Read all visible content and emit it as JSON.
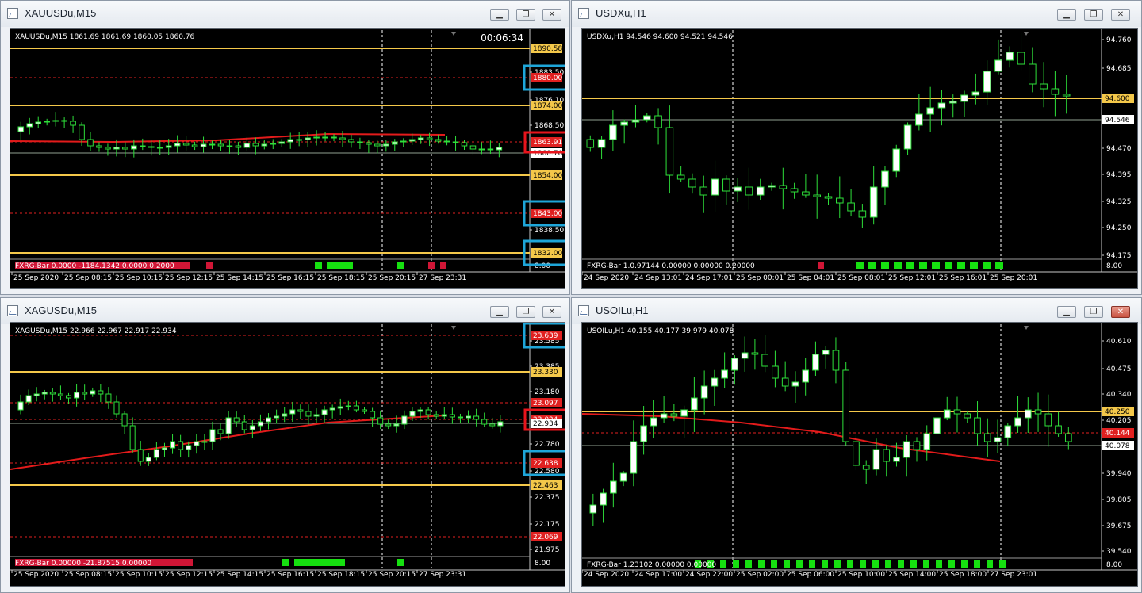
{
  "windows": [
    {
      "title": "XAUUSDu,M15",
      "info": "XAUUSDu,M15  1861.69 1861.69 1860.05 1860.76",
      "timer": "00:06:34",
      "indicator": "FXRG-Bar 0.0000  -1184.1342 0.0000 0.2000",
      "price_labels": [
        "1883.50",
        "1876.10",
        "1868.50",
        "1838.50"
      ],
      "levels": [
        {
          "label": "1890.58",
          "kind": "support",
          "boxed": false
        },
        {
          "label": "1880.00",
          "kind": "red",
          "boxed": "blue"
        },
        {
          "label": "1874.00",
          "kind": "support",
          "boxed": false
        },
        {
          "label": "1863.91",
          "kind": "red",
          "boxed": "red"
        },
        {
          "label": "1860.76",
          "kind": "current",
          "boxed": false
        },
        {
          "label": "1854.00",
          "kind": "support",
          "boxed": false
        },
        {
          "label": "1843.00",
          "kind": "red",
          "boxed": "blue"
        },
        {
          "label": "1832.00",
          "kind": "support",
          "boxed": "blue"
        }
      ],
      "axis_right_label": "8.00",
      "time_labels": [
        "25 Sep 2020",
        "25 Sep 08:15",
        "25 Sep 10:15",
        "25 Sep 12:15",
        "25 Sep 14:15",
        "25 Sep 16:15",
        "25 Sep 18:15",
        "25 Sep 20:15",
        "27 Sep 23:31"
      ]
    },
    {
      "title": "USDXu,H1",
      "info": "USDXu,H1  94.546 94.600 94.521 94.546",
      "timer": "",
      "indicator": "FXRG-Bar 1.0.97144 0.00000 0.00000 0.20000",
      "price_labels": [
        "94.760",
        "94.685",
        "94.470",
        "94.395",
        "94.325",
        "94.250",
        "94.175"
      ],
      "levels": [
        {
          "label": "94.600",
          "kind": "support",
          "boxed": false
        },
        {
          "label": "94.546",
          "kind": "current",
          "boxed": false
        }
      ],
      "axis_right_label": "8.00",
      "time_labels": [
        "24 Sep 2020",
        "24 Sep 13:01",
        "24 Sep 17:01",
        "25 Sep 00:01",
        "25 Sep 04:01",
        "25 Sep 08:01",
        "25 Sep 12:01",
        "25 Sep 16:01",
        "25 Sep 20:01"
      ]
    },
    {
      "title": "XAGUSDu,M15",
      "info": "XAGUSDu,M15  22.966 22.967 22.917 22.934",
      "timer": "",
      "indicator": "FXRG-Bar 0.00000 -21.87515 0.00000",
      "price_labels": [
        "23.585",
        "23.385",
        "23.180",
        "22.780",
        "22.580",
        "22.375",
        "22.175",
        "21.975"
      ],
      "levels": [
        {
          "label": "23.639",
          "kind": "red",
          "boxed": "blue"
        },
        {
          "label": "23.330",
          "kind": "support",
          "boxed": false
        },
        {
          "label": "23.097",
          "kind": "red",
          "boxed": false
        },
        {
          "label": "23.024",
          "kind": "red",
          "boxed": "red"
        },
        {
          "label": "22.934",
          "kind": "current",
          "boxed": "red"
        },
        {
          "label": "22.638",
          "kind": "red",
          "boxed": "blue"
        },
        {
          "label": "22.463",
          "kind": "support",
          "boxed": false
        },
        {
          "label": "22.069",
          "kind": "red",
          "boxed": false
        }
      ],
      "axis_right_label": "8.00",
      "time_labels": [
        "25 Sep 2020",
        "25 Sep 08:15",
        "25 Sep 10:15",
        "25 Sep 12:15",
        "25 Sep 14:15",
        "25 Sep 16:15",
        "25 Sep 18:15",
        "25 Sep 20:15",
        "27 Sep 23:31"
      ]
    },
    {
      "title": "USOILu,H1",
      "info": "USOILu,H1  40.155 40.177 39.979 40.078",
      "timer": "",
      "indicator": "FXRG-Bar 1.23102 0.00000 0.00000",
      "price_labels": [
        "40.610",
        "40.475",
        "40.340",
        "40.205",
        "39.940",
        "39.805",
        "39.675",
        "39.540"
      ],
      "levels": [
        {
          "label": "40.250",
          "kind": "support",
          "boxed": false
        },
        {
          "label": "40.144",
          "kind": "red",
          "boxed": false
        },
        {
          "label": "40.078",
          "kind": "current",
          "boxed": false
        }
      ],
      "axis_right_label": "8.00",
      "time_labels": [
        "24 Sep 2020",
        "24 Sep 17:00",
        "24 Sep 22:00",
        "25 Sep 02:00",
        "25 Sep 06:00",
        "25 Sep 10:00",
        "25 Sep 14:00",
        "25 Sep 18:00",
        "27 Sep 23:01"
      ]
    }
  ],
  "window_buttons": {
    "minimize": "▁",
    "restore": "❐",
    "close": "✕"
  },
  "colors": {
    "background": "#000000",
    "support_line": "#f4c84a",
    "red_level": "#e02020",
    "moving_average": "#e31b1b",
    "bull_candle": "#ffffff",
    "candle_outline": "#2ee03a",
    "blue_box": "#1ea6d9",
    "red_box": "#e8141c",
    "indicator_green": "#16e010",
    "indicator_red": "#d01636"
  }
}
